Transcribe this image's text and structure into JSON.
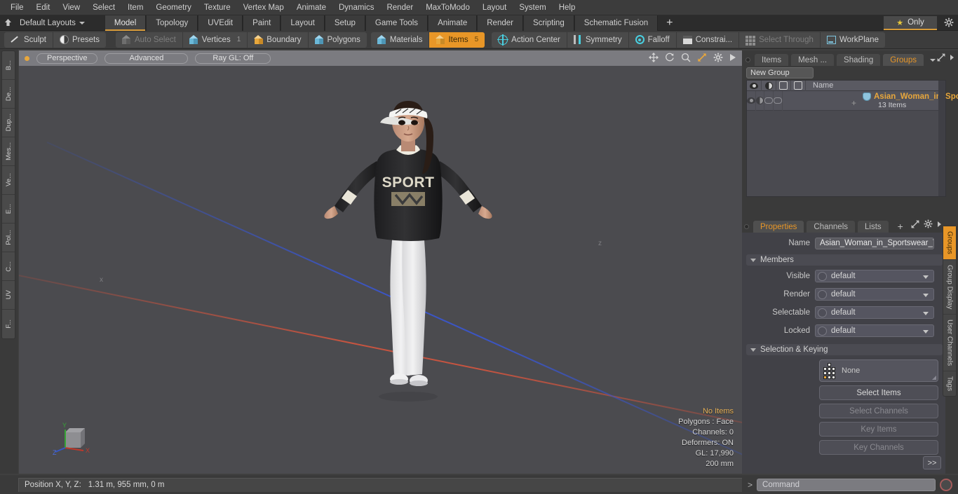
{
  "menubar": {
    "items": [
      "File",
      "Edit",
      "View",
      "Select",
      "Item",
      "Geometry",
      "Texture",
      "Vertex Map",
      "Animate",
      "Dynamics",
      "Render",
      "MaxToModo",
      "Layout",
      "System",
      "Help"
    ]
  },
  "layoutbar": {
    "home_icon": "home-icon",
    "layout_name": "Default Layouts",
    "tabs": [
      {
        "label": "Model",
        "active": true
      },
      {
        "label": "Topology",
        "active": false
      },
      {
        "label": "UVEdit",
        "active": false
      },
      {
        "label": "Paint",
        "active": false
      },
      {
        "label": "Layout",
        "active": false
      },
      {
        "label": "Setup",
        "active": false
      },
      {
        "label": "Game Tools",
        "active": false
      },
      {
        "label": "Animate",
        "active": false
      },
      {
        "label": "Render",
        "active": false
      },
      {
        "label": "Scripting",
        "active": false
      },
      {
        "label": "Schematic Fusion",
        "active": false
      }
    ],
    "add_tab_label": "+",
    "only_label": "Only",
    "star_icon": "star-icon",
    "gear_icon": "gear-icon"
  },
  "toolbar": {
    "group1": [
      {
        "label": "Sculpt",
        "icon": "pencil-icon",
        "state": "normal"
      },
      {
        "label": "Presets",
        "icon": "sphere-icon",
        "state": "normal"
      }
    ],
    "group2": [
      {
        "label": "Auto Select",
        "icon": "cube-gray-icon",
        "state": "dim",
        "count": ""
      },
      {
        "label": "Vertices",
        "icon": "cube-blue-icon",
        "state": "normal",
        "count": "1"
      },
      {
        "label": "Boundary",
        "icon": "cube-orange-icon",
        "state": "normal",
        "count": ""
      },
      {
        "label": "Polygons",
        "icon": "cube-blue-icon",
        "state": "normal",
        "count": ""
      }
    ],
    "group3": [
      {
        "label": "Materials",
        "icon": "cube-blue-icon",
        "state": "normal",
        "count": ""
      },
      {
        "label": "Items",
        "icon": "cube-orange-icon",
        "state": "active",
        "count": "5"
      }
    ],
    "group4": [
      {
        "label": "Action Center",
        "icon": "crosshair-icon",
        "state": "normal"
      },
      {
        "label": "Symmetry",
        "icon": "symmetry-icon",
        "state": "normal"
      },
      {
        "label": "Falloff",
        "icon": "falloff-ring-icon",
        "state": "normal"
      },
      {
        "label": "Constrai...",
        "icon": "constraint-icon",
        "state": "normal"
      },
      {
        "label": "Select Through",
        "icon": "select-through-icon",
        "state": "dim"
      },
      {
        "label": "WorkPlane",
        "icon": "workplane-icon",
        "state": "normal"
      }
    ]
  },
  "left_tabs": [
    "B...",
    "De...",
    "Dup...",
    "Mes...",
    "Ve...",
    "E...",
    "Pol...",
    "C...",
    "UV",
    "F..."
  ],
  "viewport": {
    "dot_icon": "active-dot-icon",
    "pills": [
      "Perspective",
      "Advanced",
      "Ray GL: Off"
    ],
    "icons": [
      "move-icon",
      "rotate-icon",
      "zoom-icon",
      "fit-icon",
      "gear-icon",
      "play-icon"
    ],
    "z_label": "z",
    "x_label2": "x",
    "stats": {
      "selection": "No Items",
      "polygons": "Polygons : Face",
      "channels": "Channels: 0",
      "deformers": "Deformers: ON",
      "gl": "GL: 17,990",
      "scale": "200 mm"
    },
    "gizmo": {
      "x": "X",
      "y": "Y",
      "z": "Z"
    },
    "model": {
      "description": "Asian woman in sportswear, T-pose",
      "shirt_text": "SPORT"
    }
  },
  "rightpanel": {
    "tabs": [
      {
        "label": "Items",
        "active": false
      },
      {
        "label": "Mesh ...",
        "active": false
      },
      {
        "label": "Shading",
        "active": false
      },
      {
        "label": "Groups",
        "active": true
      }
    ],
    "tab_caret_icon": "chevron-down-icon",
    "expand_icon": "expand-icon",
    "arrow_icon": "chevron-right-icon",
    "new_group_label": "New Group",
    "list": {
      "columns": [
        "visible-eye-icon",
        "render-half-icon",
        "select-hex-icon",
        "lock-hex-icon"
      ],
      "name_header": "Name",
      "rows": [
        {
          "expander": "+",
          "icon": "group-shield-icon",
          "name": "Asian_Woman_in_Sports...",
          "sub": "13 Items"
        }
      ]
    },
    "properties": {
      "tabs": [
        {
          "label": "Properties",
          "active": true
        },
        {
          "label": "Channels",
          "active": false
        },
        {
          "label": "Lists",
          "active": false
        },
        {
          "label": "+",
          "active": false
        }
      ],
      "expand_icon": "expand-icon",
      "gear_icon": "gear-icon",
      "arrow_icon": "chevron-right-icon",
      "name_label": "Name",
      "name_value": "Asian_Woman_in_Sportswear_T_",
      "members_section": "Members",
      "fields": [
        {
          "label": "Visible",
          "value": "default"
        },
        {
          "label": "Render",
          "value": "default"
        },
        {
          "label": "Selectable",
          "value": "default"
        },
        {
          "label": "Locked",
          "value": "default"
        }
      ],
      "selection_section": "Selection & Keying",
      "selection_value": "None",
      "buttons": [
        {
          "label": "Select Items",
          "enabled": true
        },
        {
          "label": "Select Channels",
          "enabled": false
        },
        {
          "label": "Key Items",
          "enabled": false
        },
        {
          "label": "Key Channels",
          "enabled": false
        }
      ],
      "go_button": ">>"
    },
    "vertical_tabs": [
      {
        "label": "Groups",
        "active": true
      },
      {
        "label": "Group Display",
        "active": false
      },
      {
        "label": "User Channels",
        "active": false
      },
      {
        "label": "Tags",
        "active": false
      }
    ]
  },
  "statusbar": {
    "position_label": "Position X, Y, Z:",
    "position_value": "1.31 m, 955 mm, 0 m"
  },
  "commandbar": {
    "prompt": ">",
    "placeholder": "Command",
    "record_icon": "record-icon"
  }
}
